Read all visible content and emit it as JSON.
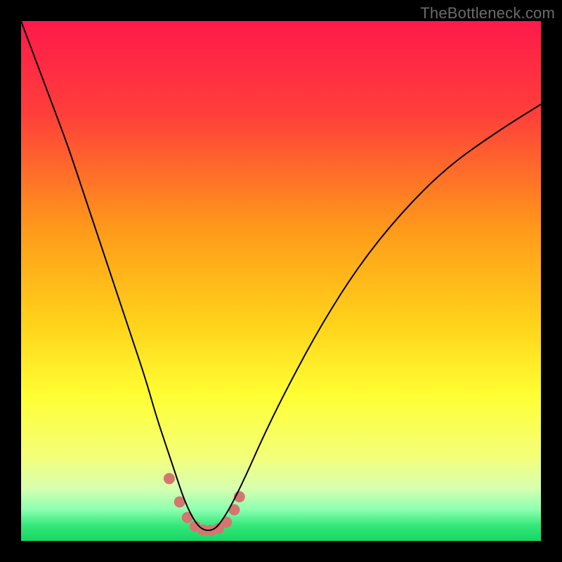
{
  "watermark": "TheBottleneck.com",
  "chart_data": {
    "type": "line",
    "title": "",
    "xlabel": "",
    "ylabel": "",
    "xlim": [
      0,
      100
    ],
    "ylim": [
      0,
      100
    ],
    "grid": false,
    "legend": false,
    "annotations": [],
    "gradient_stops": [
      {
        "offset": 0.0,
        "color": "#ff1a4b"
      },
      {
        "offset": 0.18,
        "color": "#ff3f3a"
      },
      {
        "offset": 0.4,
        "color": "#ff9a1a"
      },
      {
        "offset": 0.58,
        "color": "#ffd21a"
      },
      {
        "offset": 0.72,
        "color": "#ffff33"
      },
      {
        "offset": 0.84,
        "color": "#f3ff7a"
      },
      {
        "offset": 0.9,
        "color": "#d6ffb0"
      },
      {
        "offset": 0.94,
        "color": "#8cffb0"
      },
      {
        "offset": 0.97,
        "color": "#34e87a"
      },
      {
        "offset": 1.0,
        "color": "#17d663"
      }
    ],
    "series": [
      {
        "name": "bottleneck-curve",
        "color": "#000000",
        "x": [
          0,
          3,
          6,
          9,
          12,
          15,
          18,
          21,
          24,
          26,
          28,
          30,
          31,
          32,
          33,
          34,
          35,
          36,
          37,
          38,
          40,
          43,
          47,
          52,
          58,
          65,
          73,
          82,
          92,
          100
        ],
        "y": [
          100,
          92,
          84,
          76,
          67,
          58,
          49,
          40,
          31,
          24,
          18,
          12,
          9,
          6.5,
          4.5,
          3,
          2.2,
          2,
          2.2,
          3,
          6,
          12,
          21,
          31,
          42,
          53,
          63,
          72,
          79,
          84
        ]
      }
    ],
    "markers": {
      "name": "highlight-dots",
      "color": "#d47670",
      "radius_px": 8,
      "x": [
        28.5,
        30.5,
        32.0,
        33.5,
        35.0,
        36.5,
        38.0,
        39.5,
        41.0,
        42.0
      ],
      "y": [
        12.0,
        7.5,
        4.5,
        2.8,
        2.1,
        2.0,
        2.4,
        3.6,
        6.0,
        8.5
      ]
    }
  }
}
